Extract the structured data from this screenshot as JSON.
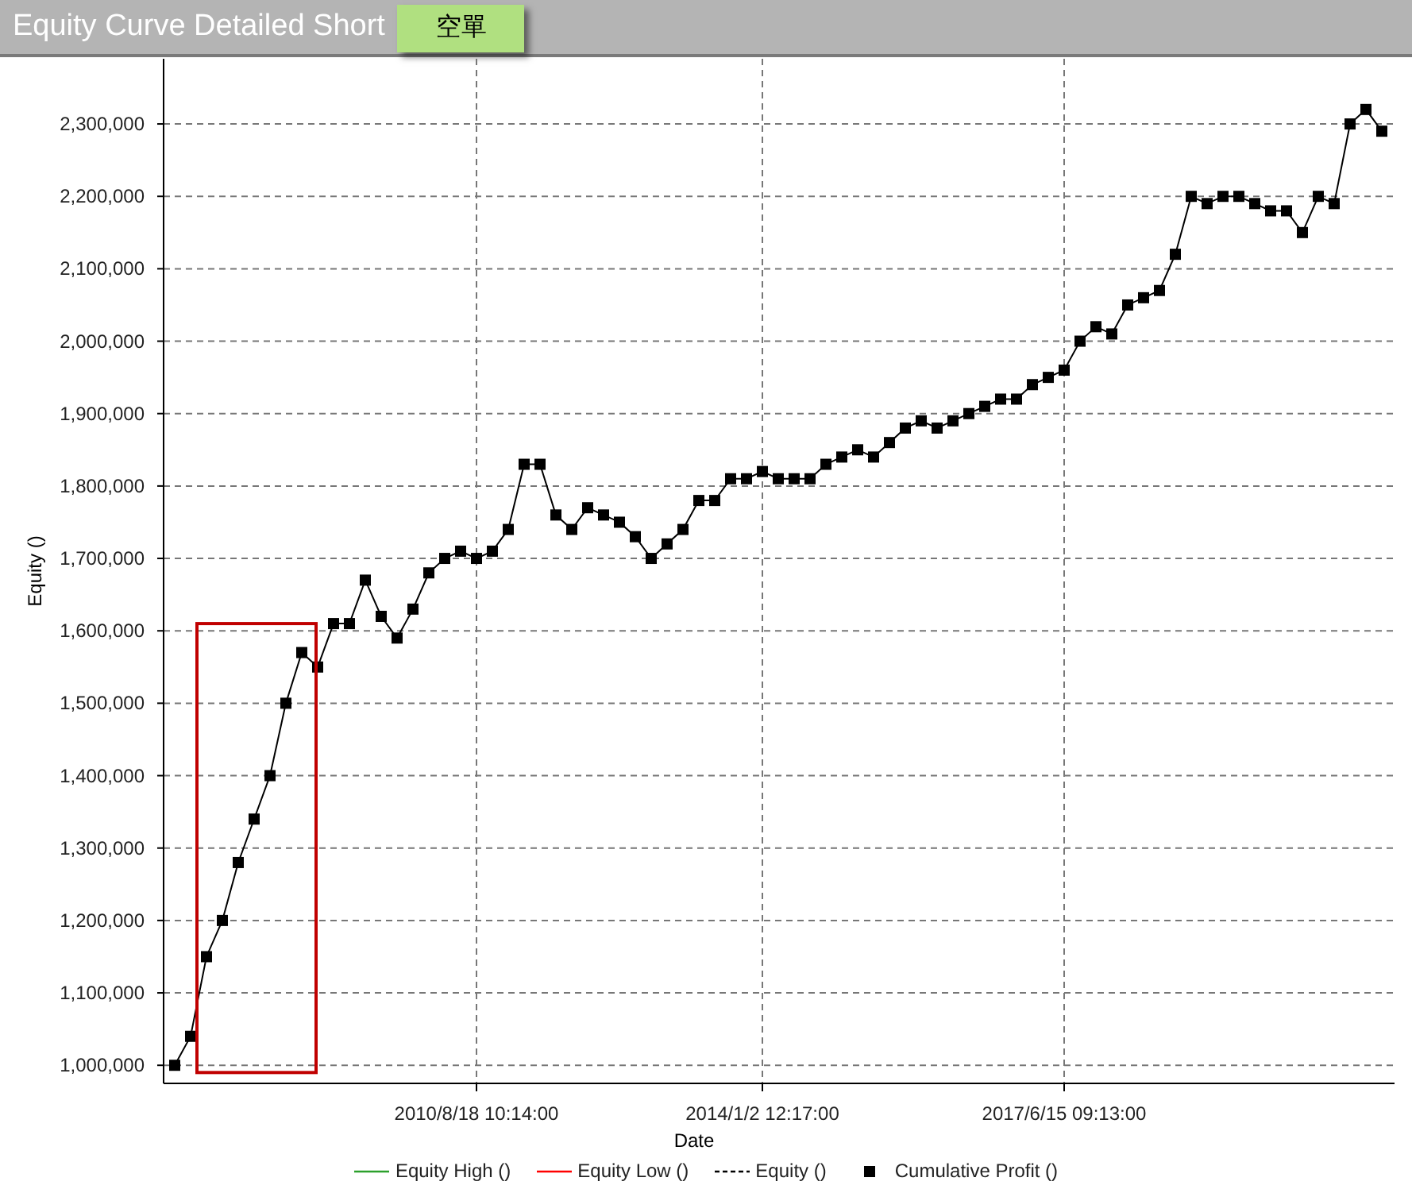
{
  "header": {
    "title": "Equity Curve Detailed Short",
    "tab": {
      "label": "空單",
      "selected": true
    }
  },
  "chart": {
    "chart_data": {
      "type": "line",
      "grid": true,
      "xlabel": "Date",
      "ylabel": "Equity ()",
      "categories": [
        null,
        null,
        null,
        null,
        null,
        null,
        null,
        null,
        null,
        null,
        null,
        null,
        null,
        null,
        null,
        null,
        null,
        null,
        null,
        "2010/8/18 10:14:00",
        null,
        null,
        null,
        null,
        null,
        null,
        null,
        null,
        null,
        null,
        null,
        null,
        null,
        null,
        null,
        null,
        null,
        "2014/1/2 12:17:00",
        null,
        null,
        null,
        null,
        null,
        null,
        null,
        null,
        null,
        null,
        null,
        null,
        null,
        null,
        null,
        null,
        null,
        null,
        "2017/6/15 09:13:00",
        null,
        null,
        null,
        null,
        null,
        null,
        null,
        null,
        null,
        null,
        null,
        null,
        null,
        null,
        null,
        null,
        null,
        null,
        null,
        null
      ],
      "series": [
        {
          "name": "Cumulative Profit ()",
          "color": "#000000",
          "marker": "square",
          "values": [
            1000000,
            1040000,
            1150000,
            1200000,
            1280000,
            1340000,
            1400000,
            1500000,
            1570000,
            1550000,
            1610000,
            1610000,
            1670000,
            1620000,
            1590000,
            1630000,
            1680000,
            1700000,
            1710000,
            1700000,
            1710000,
            1740000,
            1830000,
            1830000,
            1760000,
            1740000,
            1770000,
            1760000,
            1750000,
            1730000,
            1700000,
            1720000,
            1740000,
            1780000,
            1780000,
            1810000,
            1810000,
            1820000,
            1810000,
            1810000,
            1810000,
            1830000,
            1840000,
            1850000,
            1840000,
            1860000,
            1880000,
            1890000,
            1880000,
            1890000,
            1900000,
            1910000,
            1920000,
            1920000,
            1940000,
            1950000,
            1960000,
            2000000,
            2020000,
            2010000,
            2050000,
            2060000,
            2070000,
            2120000,
            2200000,
            2190000,
            2200000,
            2200000,
            2190000,
            2180000,
            2180000,
            2150000,
            2200000,
            2190000,
            2300000,
            2320000,
            2290000
          ]
        }
      ],
      "ylim": [
        975000,
        2390000
      ],
      "yticks": [
        {
          "value": 1000000,
          "label": "1,000,000"
        },
        {
          "value": 1100000,
          "label": "1,100,000"
        },
        {
          "value": 1200000,
          "label": "1,200,000"
        },
        {
          "value": 1300000,
          "label": "1,300,000"
        },
        {
          "value": 1400000,
          "label": "1,400,000"
        },
        {
          "value": 1500000,
          "label": "1,500,000"
        },
        {
          "value": 1600000,
          "label": "1,600,000"
        },
        {
          "value": 1700000,
          "label": "1,700,000"
        },
        {
          "value": 1800000,
          "label": "1,800,000"
        },
        {
          "value": 1900000,
          "label": "1,900,000"
        },
        {
          "value": 2000000,
          "label": "2,000,000"
        },
        {
          "value": 2100000,
          "label": "2,100,000"
        },
        {
          "value": 2200000,
          "label": "2,200,000"
        },
        {
          "value": 2300000,
          "label": "2,300,000"
        }
      ]
    },
    "highlight": {
      "color": "#c00000"
    },
    "legend": [
      {
        "label": "Equity High ()",
        "kind": "line",
        "color": "#2ca02c"
      },
      {
        "label": "Equity Low ()",
        "kind": "line",
        "color": "#ff0000"
      },
      {
        "label": "Equity ()",
        "kind": "dashed",
        "color": "#000000"
      }
    ]
  }
}
